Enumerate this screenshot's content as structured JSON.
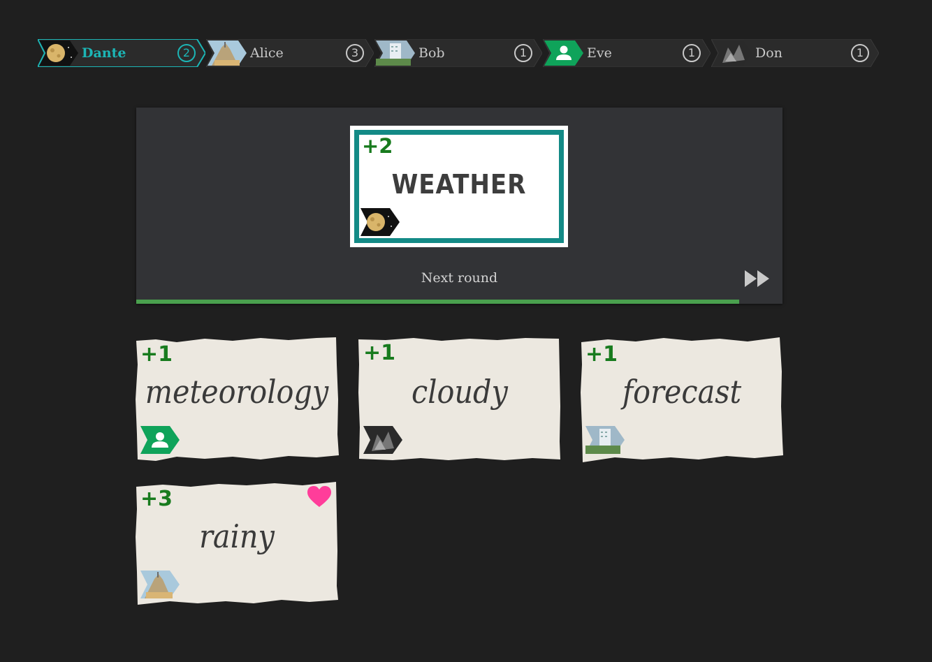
{
  "players": [
    {
      "name": "Dante",
      "score": "2",
      "active": true,
      "avatar": "moon-icon"
    },
    {
      "name": "Alice",
      "score": "3",
      "active": false,
      "avatar": "castle-photo-icon"
    },
    {
      "name": "Bob",
      "score": "1",
      "active": false,
      "avatar": "building-photo-icon"
    },
    {
      "name": "Eve",
      "score": "1",
      "active": false,
      "avatar": "person-icon"
    },
    {
      "name": "Don",
      "score": "1",
      "active": false,
      "avatar": "rock-photo-icon"
    }
  ],
  "prompt": {
    "points": "+2",
    "word": "WEATHER",
    "author": "Dante"
  },
  "next_round_label": "Next round",
  "round_progress": 0.933,
  "answers": [
    {
      "points": "+1",
      "word": "meteorology",
      "author": "Eve",
      "liked": false
    },
    {
      "points": "+1",
      "word": "cloudy",
      "author": "Don",
      "liked": false
    },
    {
      "points": "+1",
      "word": "forecast",
      "author": "Bob",
      "liked": false
    },
    {
      "points": "+3",
      "word": "rainy",
      "author": "Alice",
      "liked": true
    }
  ],
  "colors": {
    "accent": "#1cb5b5",
    "prompt_frame": "#138a86",
    "points_green": "#187b1e",
    "progress": "#4aa04e",
    "eve_green": "#0fa35a",
    "heart": "#ff3d9a"
  }
}
